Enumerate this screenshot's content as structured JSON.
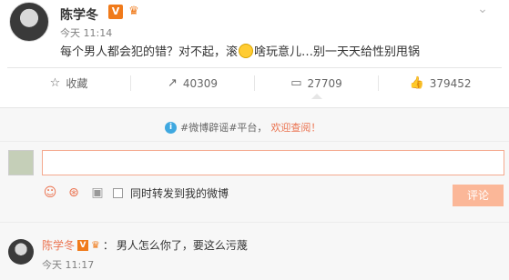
{
  "post": {
    "author": "陈学冬",
    "verified_badge": "V",
    "time": "今天 11:14",
    "text_before_emoji": "每个男人都会犯的错？对不起，滚",
    "text_after_emoji": "啥玩意儿…别一天天给性别甩锅"
  },
  "actions": [
    {
      "icon": "star-icon",
      "label": "收藏"
    },
    {
      "icon": "repost-icon",
      "label": "40309"
    },
    {
      "icon": "comment-icon",
      "label": "27709"
    },
    {
      "icon": "like-icon",
      "label": "379452"
    }
  ],
  "notice": {
    "prefix": "#微博辟谣#平台，",
    "link": "欢迎查阅！"
  },
  "composer": {
    "input_value": "",
    "repost_label": "同时转发到我的微博",
    "submit_label": "评论"
  },
  "reply": {
    "author": "陈学冬",
    "separator": "：",
    "text": "男人怎么你了，要这么污蔑",
    "time": "今天 11:17"
  },
  "colors": {
    "accent": "#eb7350",
    "badge": "#f07a1a",
    "submit_disabled": "#fbb798"
  }
}
